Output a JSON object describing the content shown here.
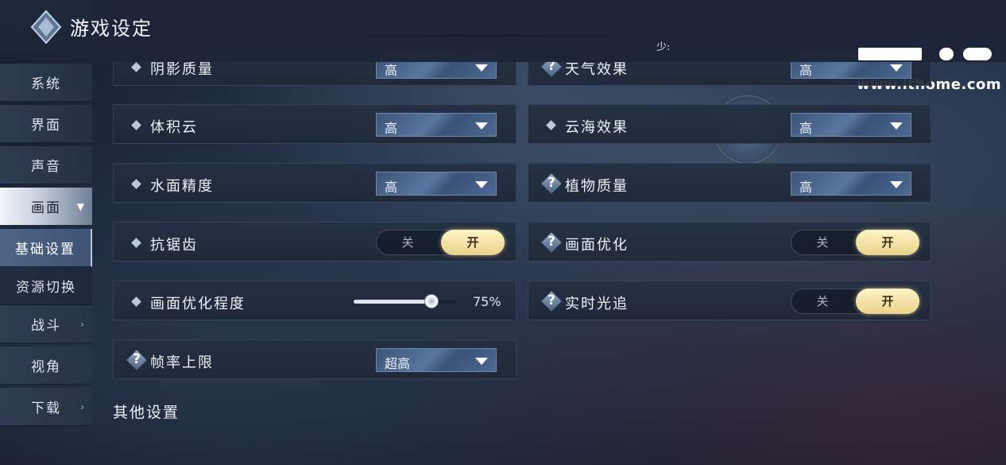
{
  "header": {
    "title": "游戏设定",
    "extra": "少:"
  },
  "watermark": {
    "url": "www.ithome.com"
  },
  "sidebar": {
    "items": [
      {
        "label": "系统"
      },
      {
        "label": "界面"
      },
      {
        "label": "声音"
      },
      {
        "label": "画面",
        "expanded": true
      },
      {
        "label": "基础设置",
        "selected": true
      },
      {
        "label": "资源切换"
      },
      {
        "label": "战斗"
      },
      {
        "label": "视角"
      },
      {
        "label": "下载"
      }
    ]
  },
  "settings": {
    "shadow_quality": {
      "label": "阴影质量",
      "value": "高"
    },
    "sky_effect": {
      "label": "天气效果",
      "value": "高"
    },
    "volumetric_cloud": {
      "label": "体积云",
      "value": "高"
    },
    "cloud_sea": {
      "label": "云海效果",
      "value": "高"
    },
    "water_precision": {
      "label": "水面精度",
      "value": "高"
    },
    "plant_quality": {
      "label": "植物质量",
      "value": "高"
    },
    "anti_aliasing": {
      "label": "抗锯齿",
      "off_label": "关",
      "on_label": "开",
      "state": "on"
    },
    "image_optimization": {
      "label": "画面优化",
      "off_label": "关",
      "on_label": "开",
      "state": "on"
    },
    "optimization_level": {
      "label": "画面优化程度",
      "value_text": "75%",
      "value_fraction": 0.75
    },
    "ray_tracing": {
      "label": "实时光追",
      "off_label": "关",
      "on_label": "开",
      "state": "on"
    },
    "frame_limit": {
      "label": "帧率上限",
      "value": "超高"
    }
  },
  "section": {
    "other_settings": "其他设置"
  },
  "icons": {
    "info": "diamond-icon",
    "help": "question-icon",
    "dropdown": "triangle-down-icon"
  }
}
